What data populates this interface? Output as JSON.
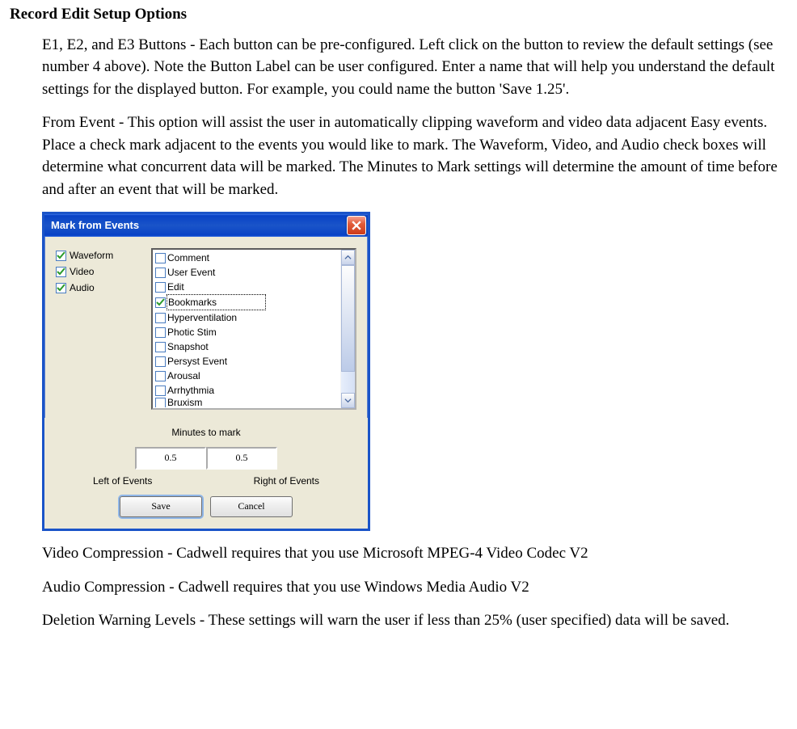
{
  "heading": "Record Edit Setup Options",
  "paragraphs": {
    "p1": "E1, E2, and E3 Buttons - Each button can be pre-configured.  Left click on the button to review the default settings (see number 4 above).  Note the Button Label can be user configured.  Enter a name that will help you understand the default settings for the displayed button.  For example, you could name the button 'Save 1.25'.",
    "p2": "From Event - This option will assist the user in automatically clipping waveform and video data adjacent Easy events.  Place a check mark adjacent to the events you would like to mark.  The Waveform, Video, and Audio check boxes will determine what concurrent data will be marked.  The Minutes to Mark settings will determine the amount of time before and after an event that will be marked.",
    "p3": "Video Compression - Cadwell requires that you use Microsoft MPEG-4 Video Codec V2",
    "p4": "Audio Compression - Cadwell requires that you use Windows Media Audio V2",
    "p5": "Deletion Warning Levels - These settings will warn the user if less than 25% (user specified) data will be saved."
  },
  "dialog": {
    "title": "Mark from Events",
    "left_checks": [
      {
        "label": "Waveform",
        "checked": true
      },
      {
        "label": "Video",
        "checked": true
      },
      {
        "label": "Audio",
        "checked": true
      }
    ],
    "list_items": [
      {
        "label": "Comment",
        "checked": false
      },
      {
        "label": "User Event",
        "checked": false
      },
      {
        "label": "Edit",
        "checked": false
      },
      {
        "label": "Bookmarks",
        "checked": true,
        "focused": true
      },
      {
        "label": "Hyperventilation",
        "checked": false
      },
      {
        "label": "Photic Stim",
        "checked": false
      },
      {
        "label": "Snapshot",
        "checked": false
      },
      {
        "label": "Persyst Event",
        "checked": false
      },
      {
        "label": "Arousal",
        "checked": false
      },
      {
        "label": "Arrhythmia",
        "checked": false
      },
      {
        "label": "Bruxism",
        "checked": false,
        "cut": true
      }
    ],
    "minutes_title": "Minutes to mark",
    "left_value": "0.5",
    "right_value": "0.5",
    "left_label": "Left of Events",
    "right_label": "Right of Events",
    "save": "Save",
    "cancel": "Cancel"
  }
}
